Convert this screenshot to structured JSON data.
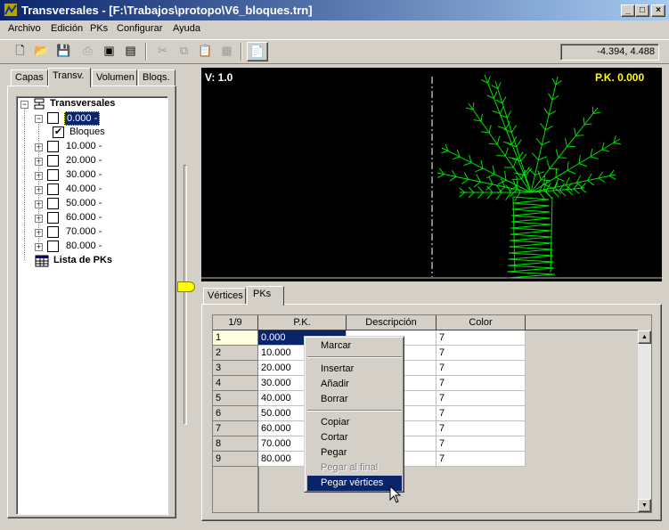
{
  "window": {
    "title": "Transversales - [F:\\Trabajos\\protopo\\V6_bloques.trn]"
  },
  "menu": [
    "Archivo",
    "Edición",
    "PKs",
    "Configurar",
    "Ayuda"
  ],
  "toolbar": {
    "coords": "-4.394, 4.488"
  },
  "left_tabs": [
    "Capas",
    "Transv.",
    "Volumen",
    "Bloqs."
  ],
  "tree": {
    "root": "Transversales",
    "first": "0.000 -",
    "bloques": "Bloques",
    "items": [
      "10.000 -",
      "20.000 -",
      "30.000 -",
      "40.000 -",
      "50.000 -",
      "60.000 -",
      "70.000 -",
      "80.000 -"
    ],
    "lista": "Lista de PKs"
  },
  "view": {
    "v_label": "V: 1.0",
    "pk_label": "P.K. 0.000"
  },
  "bottom_tabs": [
    "Vértices",
    "PKs"
  ],
  "grid": {
    "corner": "1/9",
    "headers": [
      "P.K.",
      "Descripción",
      "Color"
    ],
    "rows": [
      {
        "n": "1",
        "pk": "0.000",
        "color": "7"
      },
      {
        "n": "2",
        "pk": "10.000",
        "color": "7"
      },
      {
        "n": "3",
        "pk": "20.000",
        "color": "7"
      },
      {
        "n": "4",
        "pk": "30.000",
        "color": "7"
      },
      {
        "n": "5",
        "pk": "40.000",
        "color": "7"
      },
      {
        "n": "6",
        "pk": "50.000",
        "color": "7"
      },
      {
        "n": "7",
        "pk": "60.000",
        "color": "7"
      },
      {
        "n": "8",
        "pk": "70.000",
        "color": "7"
      },
      {
        "n": "9",
        "pk": "80.000",
        "color": "7"
      }
    ]
  },
  "context_menu": [
    "Marcar",
    "Insertar",
    "Añadir",
    "Borrar",
    "Copiar",
    "Cortar",
    "Pegar",
    "Pegar al final",
    "Pegar vértices"
  ]
}
